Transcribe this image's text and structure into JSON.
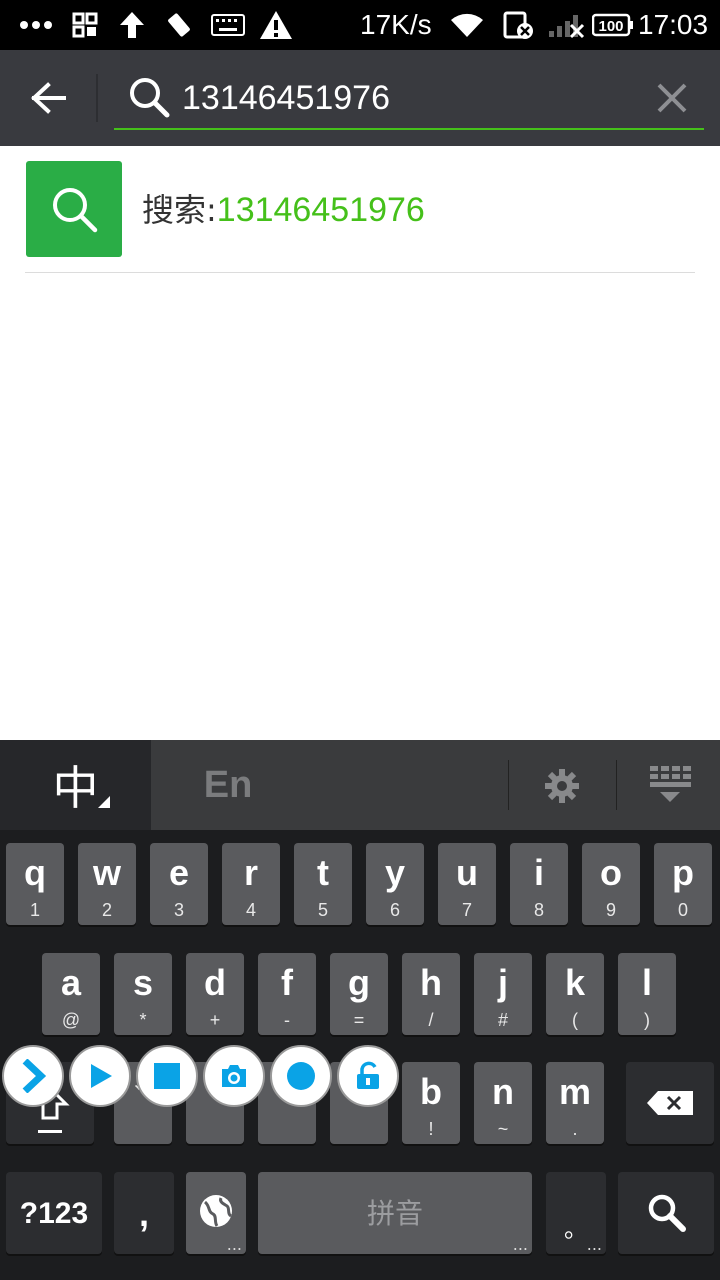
{
  "status_bar": {
    "speed": "17K/s",
    "battery": "100",
    "time": "17:03",
    "icons": [
      "more-dots-icon",
      "grid-icon",
      "upload-arrow-icon",
      "satellite-icon",
      "keyboard-icon",
      "warning-icon",
      "wifi-icon",
      "sim-blocked-icon",
      "signal-icon",
      "battery-icon"
    ]
  },
  "search": {
    "query": "13146451976",
    "accent_color": "#45c01a",
    "header_color": "#393a3f"
  },
  "result": {
    "prefix": "搜索:",
    "query": "13146451976",
    "icon_bg": "#2aad46"
  },
  "keyboard": {
    "tab_zh": "中",
    "tab_en": "En",
    "row1": [
      {
        "main": "q",
        "sub": "1"
      },
      {
        "main": "w",
        "sub": "2"
      },
      {
        "main": "e",
        "sub": "3"
      },
      {
        "main": "r",
        "sub": "4"
      },
      {
        "main": "t",
        "sub": "5"
      },
      {
        "main": "y",
        "sub": "6"
      },
      {
        "main": "u",
        "sub": "7"
      },
      {
        "main": "i",
        "sub": "8"
      },
      {
        "main": "o",
        "sub": "9"
      },
      {
        "main": "p",
        "sub": "0"
      }
    ],
    "row2": [
      {
        "main": "a",
        "sub": "@"
      },
      {
        "main": "s",
        "sub": "*"
      },
      {
        "main": "d",
        "sub": "+"
      },
      {
        "main": "f",
        "sub": "-"
      },
      {
        "main": "g",
        "sub": "="
      },
      {
        "main": "h",
        "sub": "/"
      },
      {
        "main": "j",
        "sub": "#"
      },
      {
        "main": "k",
        "sub": "("
      },
      {
        "main": "l",
        "sub": ")"
      }
    ],
    "row3": [
      {
        "main": "",
        "sub": "、"
      },
      {
        "main": "",
        "sub": ":"
      },
      {
        "main": "",
        "sub": "\""
      },
      {
        "main": "",
        "sub": "?"
      },
      {
        "main": "b",
        "sub": "!"
      },
      {
        "main": "n",
        "sub": "~"
      },
      {
        "main": "m",
        "sub": "."
      }
    ],
    "symbols_label": "?123",
    "comma_label": ",",
    "space_label": "拼音",
    "period_label": "。",
    "ellipsis": "..."
  },
  "floating_toolbar": [
    "chevron-right-icon",
    "play-icon",
    "stop-icon",
    "camera-icon",
    "record-icon",
    "unlock-icon"
  ]
}
